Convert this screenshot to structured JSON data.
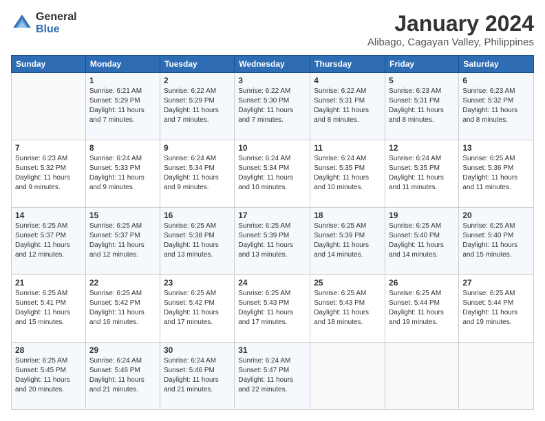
{
  "logo": {
    "general": "General",
    "blue": "Blue"
  },
  "header": {
    "title": "January 2024",
    "subtitle": "Alibago, Cagayan Valley, Philippines"
  },
  "weekdays": [
    "Sunday",
    "Monday",
    "Tuesday",
    "Wednesday",
    "Thursday",
    "Friday",
    "Saturday"
  ],
  "weeks": [
    [
      {
        "day": "",
        "info": ""
      },
      {
        "day": "1",
        "info": "Sunrise: 6:21 AM\nSunset: 5:29 PM\nDaylight: 11 hours\nand 7 minutes."
      },
      {
        "day": "2",
        "info": "Sunrise: 6:22 AM\nSunset: 5:29 PM\nDaylight: 11 hours\nand 7 minutes."
      },
      {
        "day": "3",
        "info": "Sunrise: 6:22 AM\nSunset: 5:30 PM\nDaylight: 11 hours\nand 7 minutes."
      },
      {
        "day": "4",
        "info": "Sunrise: 6:22 AM\nSunset: 5:31 PM\nDaylight: 11 hours\nand 8 minutes."
      },
      {
        "day": "5",
        "info": "Sunrise: 6:23 AM\nSunset: 5:31 PM\nDaylight: 11 hours\nand 8 minutes."
      },
      {
        "day": "6",
        "info": "Sunrise: 6:23 AM\nSunset: 5:32 PM\nDaylight: 11 hours\nand 8 minutes."
      }
    ],
    [
      {
        "day": "7",
        "info": "Sunrise: 6:23 AM\nSunset: 5:32 PM\nDaylight: 11 hours\nand 9 minutes."
      },
      {
        "day": "8",
        "info": "Sunrise: 6:24 AM\nSunset: 5:33 PM\nDaylight: 11 hours\nand 9 minutes."
      },
      {
        "day": "9",
        "info": "Sunrise: 6:24 AM\nSunset: 5:34 PM\nDaylight: 11 hours\nand 9 minutes."
      },
      {
        "day": "10",
        "info": "Sunrise: 6:24 AM\nSunset: 5:34 PM\nDaylight: 11 hours\nand 10 minutes."
      },
      {
        "day": "11",
        "info": "Sunrise: 6:24 AM\nSunset: 5:35 PM\nDaylight: 11 hours\nand 10 minutes."
      },
      {
        "day": "12",
        "info": "Sunrise: 6:24 AM\nSunset: 5:35 PM\nDaylight: 11 hours\nand 11 minutes."
      },
      {
        "day": "13",
        "info": "Sunrise: 6:25 AM\nSunset: 5:36 PM\nDaylight: 11 hours\nand 11 minutes."
      }
    ],
    [
      {
        "day": "14",
        "info": "Sunrise: 6:25 AM\nSunset: 5:37 PM\nDaylight: 11 hours\nand 12 minutes."
      },
      {
        "day": "15",
        "info": "Sunrise: 6:25 AM\nSunset: 5:37 PM\nDaylight: 11 hours\nand 12 minutes."
      },
      {
        "day": "16",
        "info": "Sunrise: 6:25 AM\nSunset: 5:38 PM\nDaylight: 11 hours\nand 13 minutes."
      },
      {
        "day": "17",
        "info": "Sunrise: 6:25 AM\nSunset: 5:39 PM\nDaylight: 11 hours\nand 13 minutes."
      },
      {
        "day": "18",
        "info": "Sunrise: 6:25 AM\nSunset: 5:39 PM\nDaylight: 11 hours\nand 14 minutes."
      },
      {
        "day": "19",
        "info": "Sunrise: 6:25 AM\nSunset: 5:40 PM\nDaylight: 11 hours\nand 14 minutes."
      },
      {
        "day": "20",
        "info": "Sunrise: 6:25 AM\nSunset: 5:40 PM\nDaylight: 11 hours\nand 15 minutes."
      }
    ],
    [
      {
        "day": "21",
        "info": "Sunrise: 6:25 AM\nSunset: 5:41 PM\nDaylight: 11 hours\nand 15 minutes."
      },
      {
        "day": "22",
        "info": "Sunrise: 6:25 AM\nSunset: 5:42 PM\nDaylight: 11 hours\nand 16 minutes."
      },
      {
        "day": "23",
        "info": "Sunrise: 6:25 AM\nSunset: 5:42 PM\nDaylight: 11 hours\nand 17 minutes."
      },
      {
        "day": "24",
        "info": "Sunrise: 6:25 AM\nSunset: 5:43 PM\nDaylight: 11 hours\nand 17 minutes."
      },
      {
        "day": "25",
        "info": "Sunrise: 6:25 AM\nSunset: 5:43 PM\nDaylight: 11 hours\nand 18 minutes."
      },
      {
        "day": "26",
        "info": "Sunrise: 6:25 AM\nSunset: 5:44 PM\nDaylight: 11 hours\nand 19 minutes."
      },
      {
        "day": "27",
        "info": "Sunrise: 6:25 AM\nSunset: 5:44 PM\nDaylight: 11 hours\nand 19 minutes."
      }
    ],
    [
      {
        "day": "28",
        "info": "Sunrise: 6:25 AM\nSunset: 5:45 PM\nDaylight: 11 hours\nand 20 minutes."
      },
      {
        "day": "29",
        "info": "Sunrise: 6:24 AM\nSunset: 5:46 PM\nDaylight: 11 hours\nand 21 minutes."
      },
      {
        "day": "30",
        "info": "Sunrise: 6:24 AM\nSunset: 5:46 PM\nDaylight: 11 hours\nand 21 minutes."
      },
      {
        "day": "31",
        "info": "Sunrise: 6:24 AM\nSunset: 5:47 PM\nDaylight: 11 hours\nand 22 minutes."
      },
      {
        "day": "",
        "info": ""
      },
      {
        "day": "",
        "info": ""
      },
      {
        "day": "",
        "info": ""
      }
    ]
  ]
}
